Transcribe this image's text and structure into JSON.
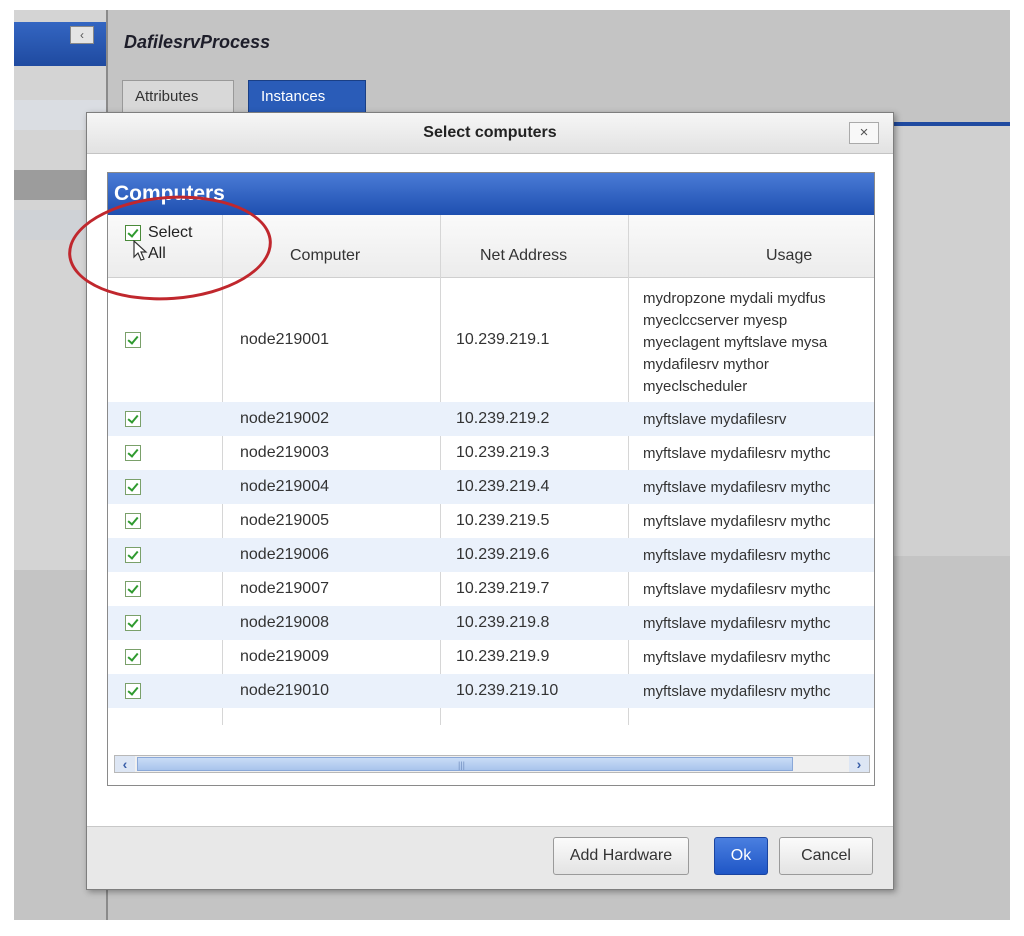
{
  "app": {
    "process_title": "DafilesrvProcess",
    "tabs": [
      {
        "label": "Attributes",
        "active": false
      },
      {
        "label": "Instances",
        "active": true
      }
    ],
    "collapse_icon": "chevron-left-icon"
  },
  "dialog": {
    "title": "Select computers",
    "close_label": "×",
    "grid": {
      "title": "Computers",
      "select_all": {
        "line1": "Select",
        "line2": "All",
        "checked": true
      },
      "columns": [
        "Computer",
        "Net Address",
        "Usage"
      ],
      "rows": [
        {
          "checked": true,
          "computer": "node219001",
          "net_address": "10.239.219.1",
          "usage_lines": [
            "mydropzone mydali mydfus",
            "myeclccserver myesp",
            "myeclagent myftslave mysa",
            "mydafilesrv mythor",
            "myeclscheduler"
          ]
        },
        {
          "checked": true,
          "computer": "node219002",
          "net_address": "10.239.219.2",
          "usage": "myftslave mydafilesrv"
        },
        {
          "checked": true,
          "computer": "node219003",
          "net_address": "10.239.219.3",
          "usage": "myftslave mydafilesrv mythc"
        },
        {
          "checked": true,
          "computer": "node219004",
          "net_address": "10.239.219.4",
          "usage": "myftslave mydafilesrv mythc"
        },
        {
          "checked": true,
          "computer": "node219005",
          "net_address": "10.239.219.5",
          "usage": "myftslave mydafilesrv mythc"
        },
        {
          "checked": true,
          "computer": "node219006",
          "net_address": "10.239.219.6",
          "usage": "myftslave mydafilesrv mythc"
        },
        {
          "checked": true,
          "computer": "node219007",
          "net_address": "10.239.219.7",
          "usage": "myftslave mydafilesrv mythc"
        },
        {
          "checked": true,
          "computer": "node219008",
          "net_address": "10.239.219.8",
          "usage": "myftslave mydafilesrv mythc"
        },
        {
          "checked": true,
          "computer": "node219009",
          "net_address": "10.239.219.9",
          "usage": "myftslave mydafilesrv mythc"
        },
        {
          "checked": true,
          "computer": "node219010",
          "net_address": "10.239.219.10",
          "usage": "myftslave mydafilesrv mythc"
        }
      ],
      "scroll_left_label": "‹",
      "scroll_right_label": "›",
      "scroll_grip": "|||"
    },
    "buttons": {
      "add_hardware": "Add Hardware",
      "ok": "Ok",
      "cancel": "Cancel"
    }
  },
  "colors": {
    "accent_blue": "#1f4aa0",
    "highlight_red": "#c0272d",
    "check_green": "#2f9a2f"
  }
}
